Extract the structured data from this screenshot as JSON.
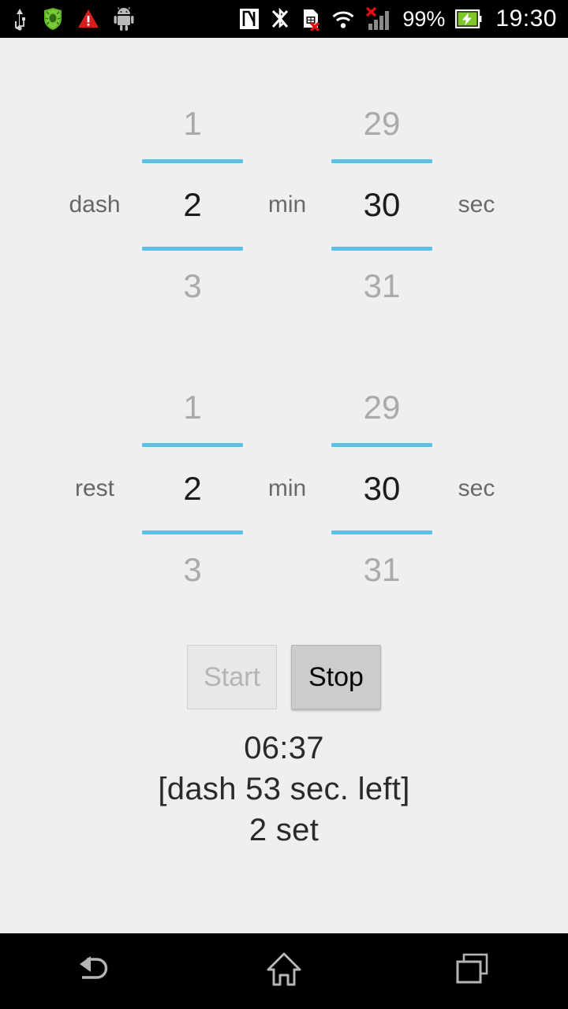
{
  "status_bar": {
    "left_icons": [
      {
        "name": "usb-icon",
        "label": "USB"
      },
      {
        "name": "antivirus-shield-icon",
        "label": "Dr.Web antivirus"
      },
      {
        "name": "warning-triangle-icon",
        "label": "Warning"
      },
      {
        "name": "android-robot-icon",
        "label": "Android"
      }
    ],
    "right_icons": [
      {
        "name": "nfc-icon",
        "label": "NFC"
      },
      {
        "name": "bluetooth-disabled-icon",
        "label": "Bluetooth off"
      },
      {
        "name": "sim-card-missing-icon",
        "label": "No SIM card"
      },
      {
        "name": "wifi-icon",
        "label": "Wi-Fi"
      },
      {
        "name": "cellular-signal-no-service-icon",
        "label": "No service"
      }
    ],
    "battery_percent": "99%",
    "battery_icon": "battery-charging-icon",
    "clock": "19:30"
  },
  "timer": {
    "rows": [
      {
        "label": "dash",
        "minutes": {
          "prev": "1",
          "current": "2",
          "next": "3"
        },
        "minutes_unit": "min",
        "seconds": {
          "prev": "29",
          "current": "30",
          "next": "31"
        },
        "seconds_unit": "sec"
      },
      {
        "label": "rest",
        "minutes": {
          "prev": "1",
          "current": "2",
          "next": "3"
        },
        "minutes_unit": "min",
        "seconds": {
          "prev": "29",
          "current": "30",
          "next": "31"
        },
        "seconds_unit": "sec"
      }
    ],
    "buttons": {
      "start_label": "Start",
      "stop_label": "Stop"
    },
    "readout": {
      "elapsed": "06:37",
      "phase": "[dash 53 sec. left]",
      "sets": "2 set"
    },
    "colors": {
      "divider_blue": "#5bc0e4",
      "background": "#efefef",
      "picker_inactive": "#aaaaaa",
      "picker_active": "#1c1c1c"
    }
  },
  "nav_bar": {
    "back_label": "Back",
    "home_label": "Home",
    "recents_label": "Recent apps"
  }
}
